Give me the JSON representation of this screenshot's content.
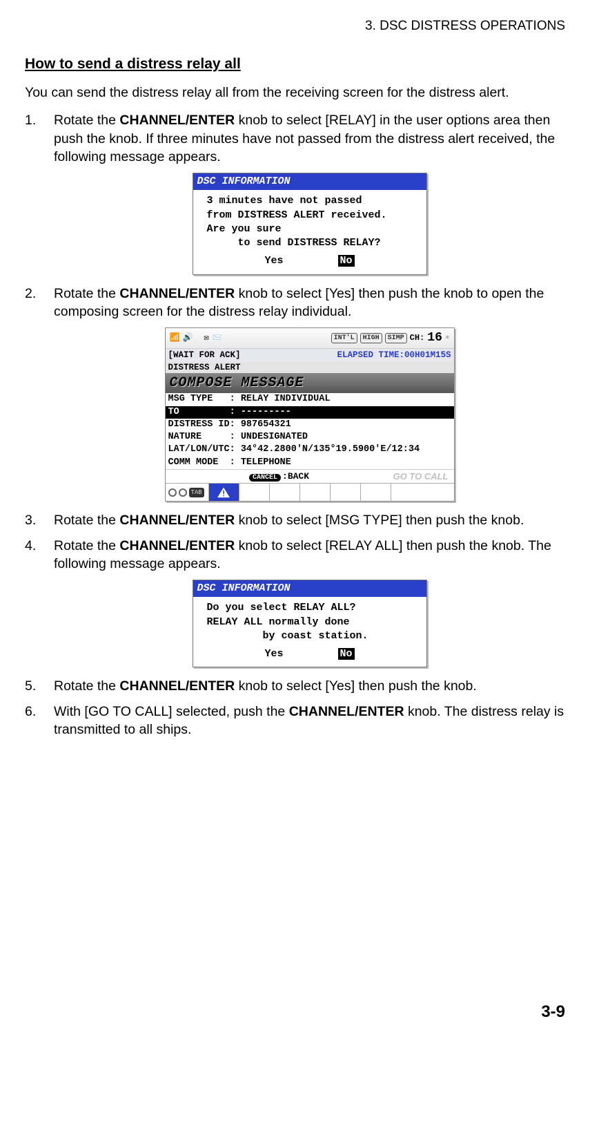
{
  "chapter_header": "3.  DSC DISTRESS OPERATIONS",
  "section_title": "How to send a distress relay all",
  "intro": "You can send the distress relay all from the receiving screen for the distress alert.",
  "steps": {
    "s1a": "Rotate the ",
    "s1b": "CHANNEL/ENTER",
    "s1c": " knob to select [RELAY] in the user options area then push the knob. If three minutes have not passed from the distress alert received, the following message appears.",
    "s2a": "Rotate the ",
    "s2b": "CHANNEL/ENTER",
    "s2c": " knob to select [Yes] then push the knob to open the composing screen for the distress relay individual.",
    "s3a": "Rotate the ",
    "s3b": "CHANNEL/ENTER",
    "s3c": " knob to select [MSG TYPE] then push the knob.",
    "s4a": "Rotate the ",
    "s4b": "CHANNEL/ENTER",
    "s4c": " knob to select [RELAY ALL] then push the knob. The following message appears.",
    "s5a": "Rotate the ",
    "s5b": "CHANNEL/ENTER",
    "s5c": " knob to select [Yes] then push the knob.",
    "s6a": "With [GO TO CALL] selected, push the ",
    "s6b": "CHANNEL/ENTER",
    "s6c": " knob. The distress relay is transmitted to all ships."
  },
  "dialog1": {
    "title": "DSC INFORMATION",
    "body": "3 minutes have not passed\nfrom DISTRESS ALERT received.\nAre you sure\n     to send DISTRESS RELAY?",
    "yes": "Yes",
    "no": "No"
  },
  "screen": {
    "badges": {
      "intl": "INT'L",
      "high": "HIGH",
      "simp": "SIMP"
    },
    "ch_label": "CH:",
    "ch_value": "16",
    "wait_left": "[WAIT FOR ACK]",
    "wait_right": "ELAPSED TIME:00H01M15S",
    "distress_alert": "DISTRESS ALERT",
    "compose_hdr": "COMPOSE MESSAGE",
    "rows": {
      "r0": "MSG TYPE   : RELAY INDIVIDUAL",
      "r1": "TO         : ---------",
      "r2": "DISTRESS ID: 987654321",
      "r3": "NATURE     : UNDESIGNATED",
      "r4": "LAT/LON/UTC: 34°42.2800'N/135°19.5900'E/12:34",
      "r5": "COMM MODE  : TELEPHONE"
    },
    "cancel_label": "CANCEL",
    "back_label": ":BACK",
    "go_label": "GO TO CALL",
    "tab_label": "TAB"
  },
  "dialog2": {
    "title": "DSC INFORMATION",
    "body": "Do you select RELAY ALL?\nRELAY ALL normally done\n         by coast station.",
    "yes": "Yes",
    "no": "No"
  },
  "page_number": "3-9"
}
